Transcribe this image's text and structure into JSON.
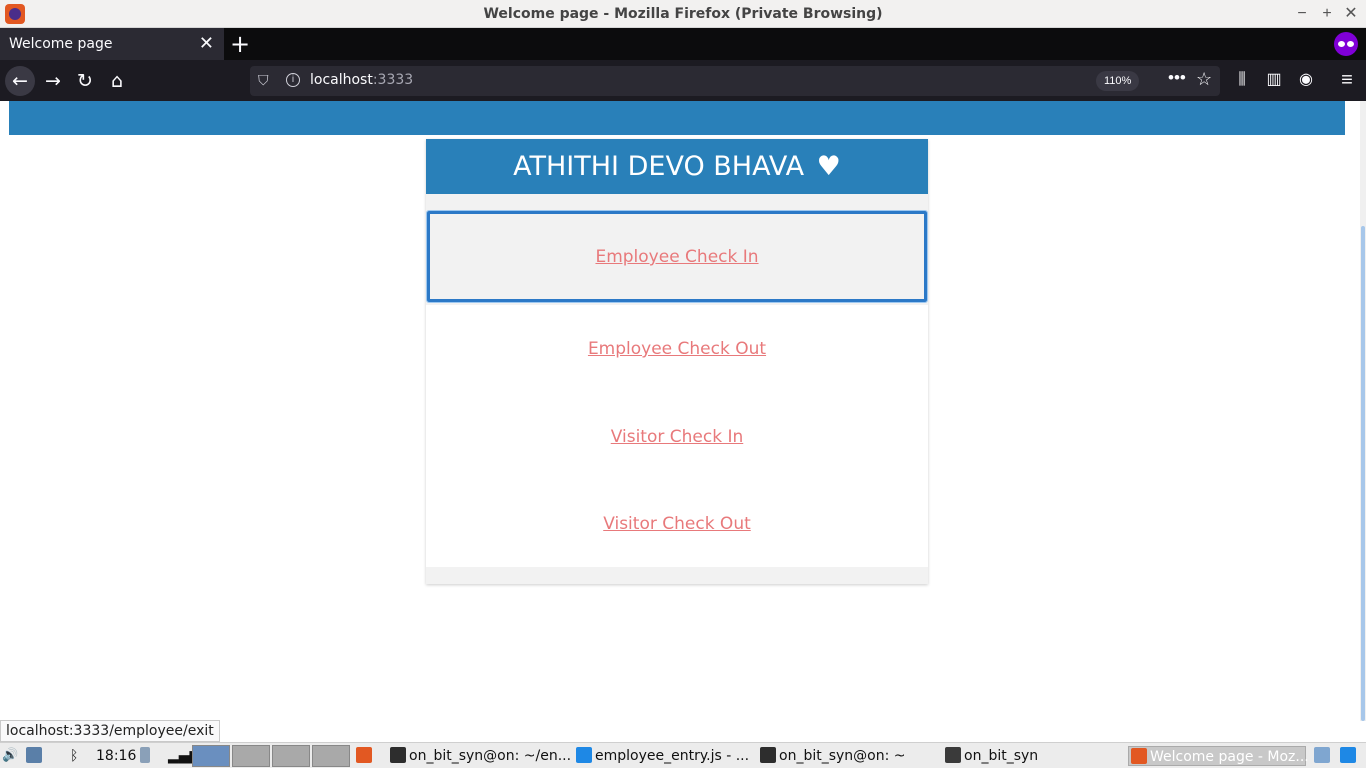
{
  "window": {
    "title": "Welcome page - Mozilla Firefox (Private Browsing)",
    "minimize": "−",
    "maximize": "+",
    "close": "✕"
  },
  "tabs": [
    {
      "label": "Welcome page",
      "close": "✕"
    }
  ],
  "newtab": "+",
  "nav": {
    "back": "←",
    "forward": "→",
    "reload": "↻",
    "home": "⌂",
    "url_host": "localhost",
    "url_port": ":3333",
    "zoom": "110%",
    "more": "•••",
    "bookmark": "☆",
    "library": "⫼",
    "sidebar": "▥",
    "account": "◉",
    "menu": "≡"
  },
  "page": {
    "heading": "ATHITHI DEVO BHAVA",
    "heart": "♥",
    "links": [
      {
        "label": "Employee Check In"
      },
      {
        "label": "Employee Check Out"
      },
      {
        "label": "Visitor Check In"
      },
      {
        "label": "Visitor Check Out"
      }
    ]
  },
  "status_url": "localhost:3333/employee/exit",
  "taskbar": {
    "clock": "18:16",
    "windows": [
      {
        "label": "on_bit_syn@on: ~/en...",
        "icon": "terminal-icon"
      },
      {
        "label": "employee_entry.js - ...",
        "icon": "vscode-icon"
      },
      {
        "label": "on_bit_syn@on: ~",
        "icon": "terminal-icon"
      },
      {
        "label": "on_bit_syn",
        "icon": "folder-icon"
      },
      {
        "label": "Welcome page - Moz...",
        "icon": "firefox-icon"
      }
    ]
  },
  "colors": {
    "brand_blue": "#2980b9",
    "link": "#e8797b",
    "focus": "#2c79c7"
  }
}
